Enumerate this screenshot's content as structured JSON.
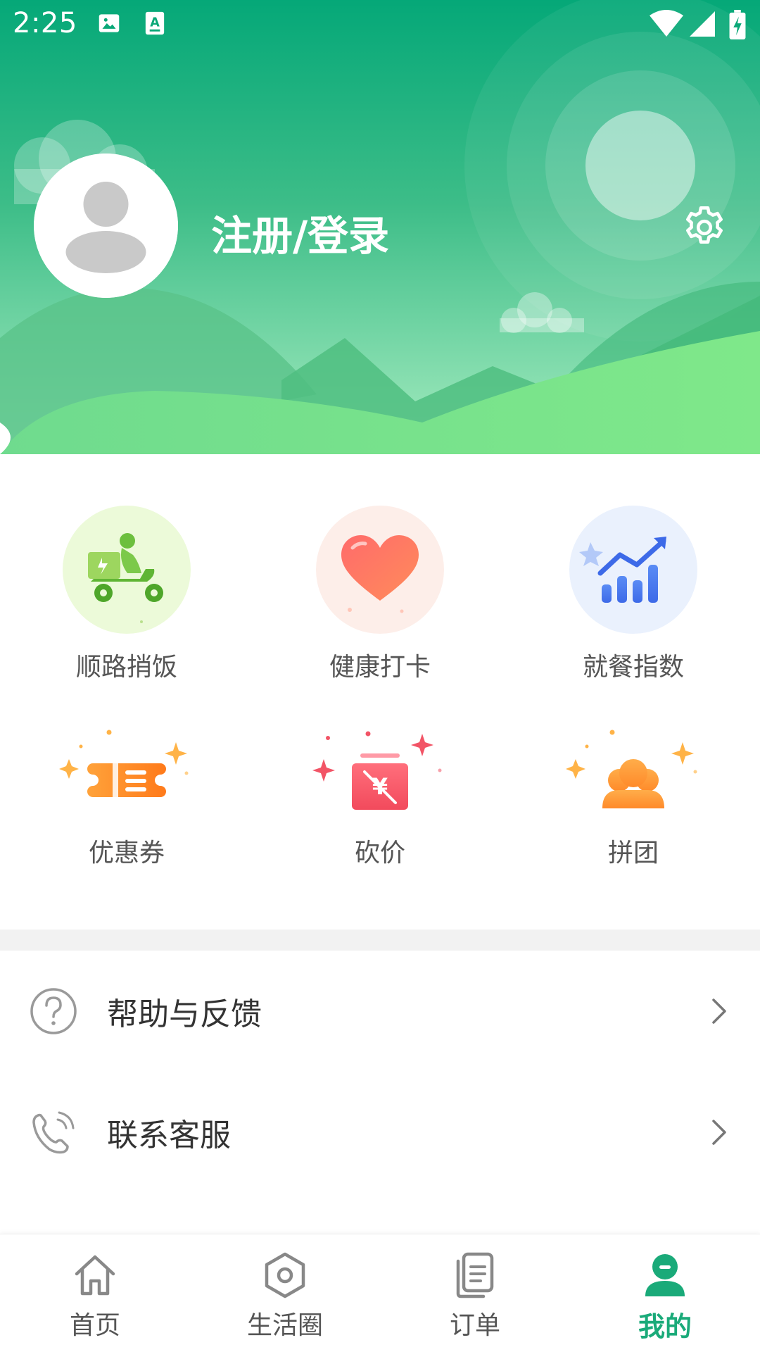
{
  "status_bar": {
    "time": "2:25",
    "icons": [
      "image-icon",
      "a11y-text-icon",
      "wifi-icon",
      "cellular-signal-icon",
      "battery-charging-icon"
    ]
  },
  "header": {
    "login_label": "注册/登录",
    "avatar_icon": "user-placeholder-icon",
    "settings_icon": "gear-icon",
    "colors": {
      "top": "#05a878",
      "mid": "#4ec88f",
      "bottom": "#8ee6a9"
    }
  },
  "features": [
    {
      "label": "顺路捎饭",
      "icon": "delivery-scooter-icon"
    },
    {
      "label": "健康打卡",
      "icon": "heart-icon"
    },
    {
      "label": "就餐指数",
      "icon": "bar-chart-trend-icon"
    },
    {
      "label": "优惠券",
      "icon": "coupon-icon"
    },
    {
      "label": "砍价",
      "icon": "yuan-price-cut-icon"
    },
    {
      "label": "拼团",
      "icon": "group-users-icon"
    }
  ],
  "menu": [
    {
      "label": "帮助与反馈",
      "icon": "help-circle-icon"
    },
    {
      "label": "联系客服",
      "icon": "phone-call-icon"
    }
  ],
  "bottom_nav": [
    {
      "label": "首页",
      "icon": "home-icon",
      "active": false
    },
    {
      "label": "生活圈",
      "icon": "hexagon-circle-icon",
      "active": false
    },
    {
      "label": "订单",
      "icon": "order-document-icon",
      "active": false
    },
    {
      "label": "我的",
      "icon": "profile-icon",
      "active": true
    }
  ],
  "accent_color": "#1aaa79"
}
